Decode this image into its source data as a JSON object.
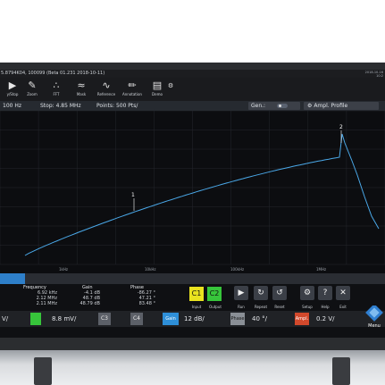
{
  "titlebar": {
    "text": "5.8794K04, 100099 (Beta 01.231 2018-10-11)",
    "datetime_line1": "2018-10-16",
    "datetime_line2": "10:2"
  },
  "toolbar": {
    "items": [
      {
        "label": "y/Stop",
        "icon": "play-icon"
      },
      {
        "label": "Zoom",
        "icon": "zoom-icon"
      },
      {
        "label": "FFT",
        "icon": "fft-icon"
      },
      {
        "label": "Mask",
        "icon": "mask-icon"
      },
      {
        "label": "Reference",
        "icon": "reference-icon"
      },
      {
        "label": "Annotation",
        "icon": "pen-icon"
      },
      {
        "label": "Demo",
        "icon": "demo-icon"
      }
    ]
  },
  "infobar": {
    "start": "100 Hz",
    "stop": "Stop: 4.85 MHz",
    "points": "Points: 500 Pts/",
    "gen_label": "Gen.:",
    "profile_label": "Ampl. Profile"
  },
  "plot": {
    "x_ticks": [
      "1kHz",
      "10kHz",
      "100kHz",
      "1MHz"
    ],
    "markers": [
      {
        "label": "1"
      },
      {
        "label": "2"
      }
    ]
  },
  "table": {
    "headers": {
      "frequency": "Frequency",
      "gain": "Gain",
      "phase": "Phase"
    },
    "rows": [
      {
        "frequency": "6.92 kHz",
        "gain": "-4.1 dB",
        "phase": "-86.27 °"
      },
      {
        "frequency": "2.12 MHz",
        "gain": "48.7 dB",
        "phase": "47.21 °"
      },
      {
        "frequency": "2.11 MHz",
        "gain": "48.79 dB",
        "phase": "83.48 °"
      }
    ]
  },
  "controls": {
    "c1": "C1",
    "c2": "C2",
    "input_label": "Input",
    "output_label": "Output",
    "run_label": "Run",
    "repeat_label": "Repeat",
    "reset_label": "Reset",
    "setup_label": "Setup",
    "help_label": "Help",
    "exit_label": "Exit"
  },
  "chanbar": {
    "ch1_scale": "V/",
    "ch2_scale": "8.8 mV/",
    "c3": "C3",
    "c4": "C4",
    "gain_label": "Gain",
    "gain_value": "12 dB/",
    "phase_label": "Phase",
    "phase_value": "40 °/",
    "ampl_label": "Ampl.",
    "ampl_value": "0.2 V/",
    "menu_label": "Menu"
  },
  "colors": {
    "trace": "#4aa8e8",
    "accent": "#2e7fc9",
    "c1": "#e9e21f",
    "c2": "#37c53b",
    "gain": "#2e8fd8",
    "phase": "#8a8f96",
    "ampl": "#d2492c"
  }
}
